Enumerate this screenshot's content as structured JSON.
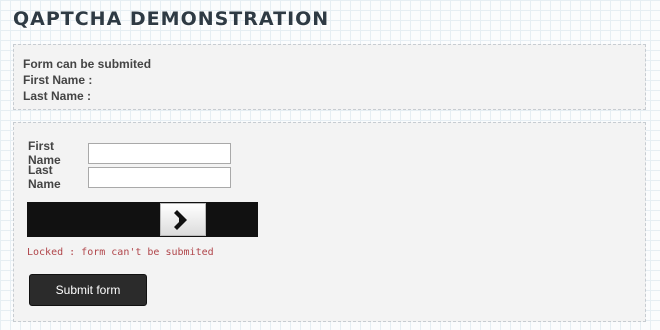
{
  "header": {
    "title": "QAPTCHA DEMONSTRATION"
  },
  "result": {
    "status": "Form can be submited",
    "first_name_label": "First Name :",
    "last_name_label": "Last Name :"
  },
  "form": {
    "first_name_label": "First Name",
    "first_name_value": "",
    "last_name_label": "Last Name",
    "last_name_value": "",
    "slider_icon": "diamond-arrow-icon",
    "lock_status": "Locked : form can't be submited",
    "submit_label": "Submit form"
  },
  "colors": {
    "lock_status": "#b0454a",
    "button_bg": "#2b2b2b",
    "slider_track": "#111111"
  }
}
